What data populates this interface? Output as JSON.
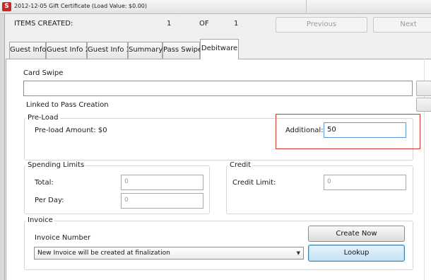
{
  "window": {
    "app_icon_letter": "S",
    "title": "2012-12-05 Gift Certificate  (Load Value: $0.00)"
  },
  "items_bar": {
    "label": "ITEMS CREATED:",
    "current": "1",
    "of": "OF",
    "total": "1",
    "previous_label": "Previous",
    "next_label": "Next"
  },
  "tabs": [
    {
      "label": "Guest Info"
    },
    {
      "label": "Guest Info 2"
    },
    {
      "label": "Guest Info 3"
    },
    {
      "label": "Summary"
    },
    {
      "label": "Pass Swipe"
    },
    {
      "label": "Debitware",
      "active": true
    }
  ],
  "card_swipe": {
    "label": "Card Swipe",
    "value": "",
    "linked_label": "Linked to Pass Creation"
  },
  "preload": {
    "title": "Pre-Load",
    "amount_label": "Pre-load Amount: $0",
    "additional_label": "Additional:",
    "additional_value": "50"
  },
  "spending_limits": {
    "title": "Spending Limits",
    "total_label": "Total:",
    "total_value": "0",
    "per_day_label": "Per Day:",
    "per_day_value": "0"
  },
  "credit": {
    "title": "Credit",
    "limit_label": "Credit Limit:",
    "limit_value": "0"
  },
  "invoice": {
    "title": "Invoice",
    "number_label": "Invoice Number",
    "selected_option": "New Invoice will be created at finalization",
    "create_now_label": "Create Now",
    "lookup_label": "Lookup"
  },
  "colors": {
    "highlight_border": "#d8352a",
    "focus_border": "#5b9bd5",
    "app_icon": "#c62828"
  }
}
